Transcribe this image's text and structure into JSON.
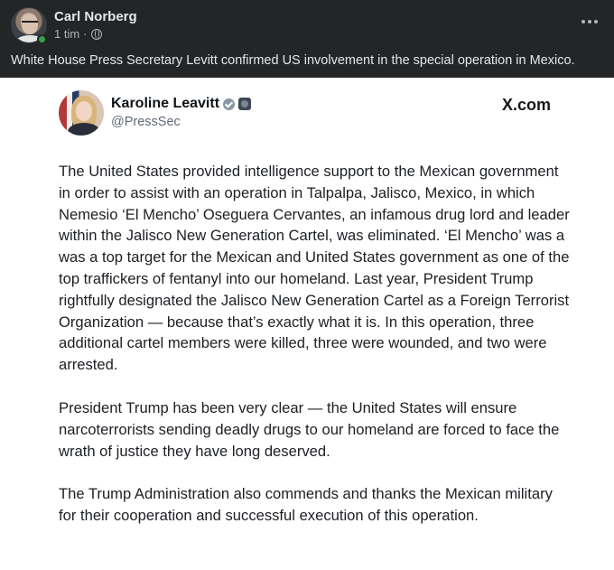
{
  "post": {
    "author": "Carl Norberg",
    "time": "1 tim",
    "separator": "·",
    "caption": "White House Press Secretary Levitt confirmed US involvement in the special operation in Mexico.",
    "icons": {
      "privacy": "globe-icon",
      "menu": "more-icon"
    }
  },
  "tweet": {
    "name": "Karoline Leavitt",
    "handle": "@PressSec",
    "site_label": "X.com",
    "paragraphs": [
      "The United States provided intelligence support to the Mexican government in order to assist with an operation in Talpalpa, Jalisco, Mexico, in which Nemesio ‘El Mencho’ Oseguera Cervantes, an infamous drug lord and leader within the Jalisco New Generation Cartel, was eliminated. ‘El Mencho’ was a was a top target for the Mexican and United States government as one of the top traffickers of fentanyl into our homeland. Last year, President Trump rightfully designated the Jalisco New Generation Cartel as a Foreign Terrorist Organization — because that’s exactly what it is. In this operation, three additional cartel members were killed, three were wounded, and two were arrested.",
      "President Trump has been very clear — the United States will ensure narcoterrorists sending deadly drugs to our homeland are forced to face the wrath of justice they have long deserved.",
      "The Trump Administration also commends and thanks the Mexican military for their cooperation and successful execution of this operation."
    ],
    "icons": {
      "verified": "verified-icon",
      "affiliation": "gov-badge-icon"
    }
  },
  "colors": {
    "dark_bg": "#242526",
    "light_bg": "#ffffff",
    "online": "#31a24c"
  }
}
